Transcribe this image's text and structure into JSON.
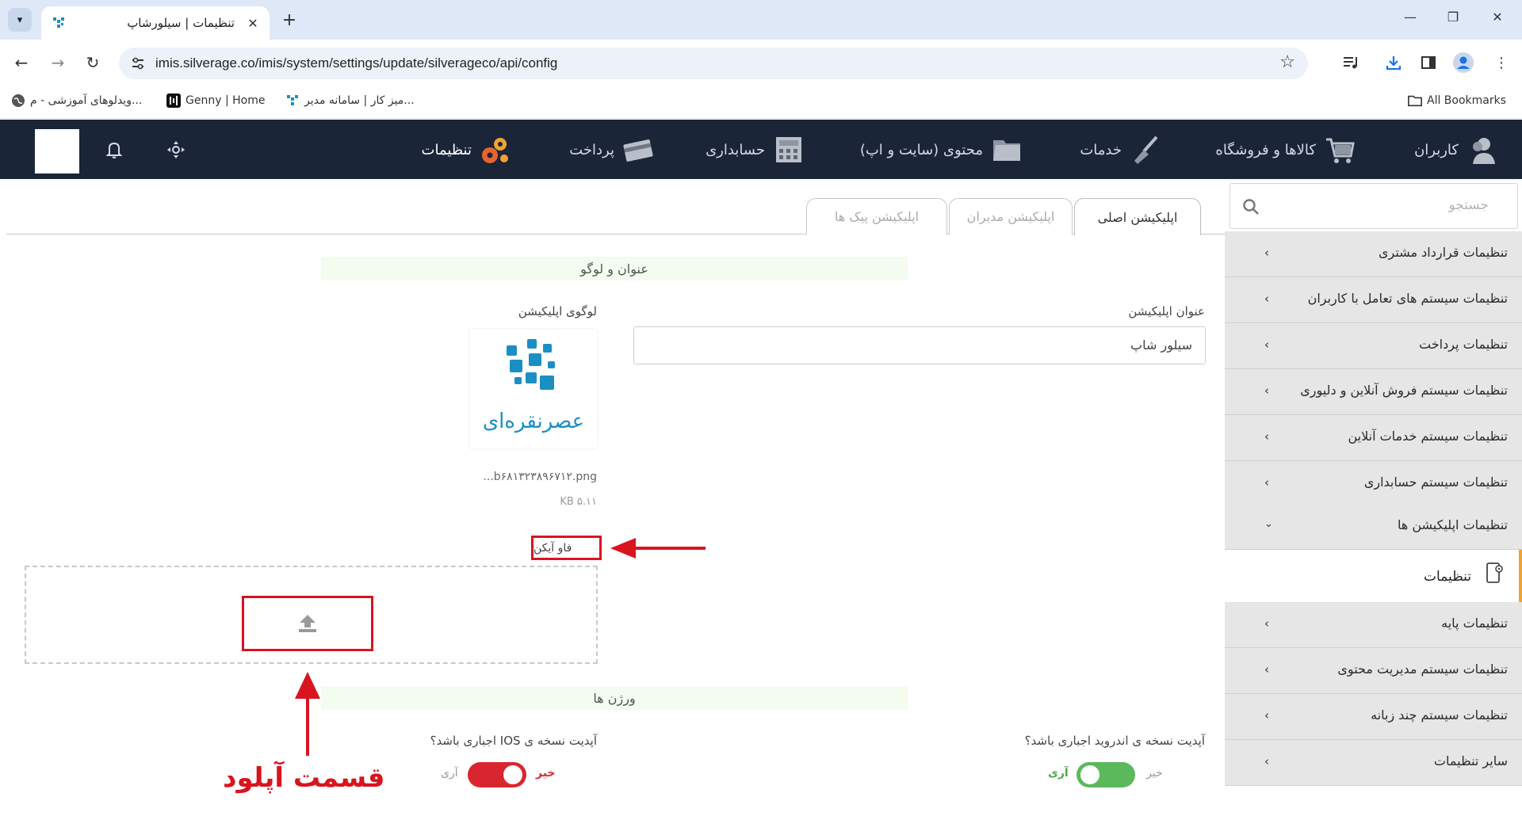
{
  "browser": {
    "tab_title": "تنظیمات | سیلورشاپ",
    "url": "imis.silverage.co/imis/system/settings/update/silverageco/api/config",
    "bookmarks": [
      {
        "label": "ویدلوهای آموزشی - م..."
      },
      {
        "label": "Genny | Home"
      },
      {
        "label": "میز کار | سامانه مدیر..."
      }
    ],
    "all_bookmarks": "All Bookmarks"
  },
  "app_nav": {
    "items": [
      {
        "label": "کاربران",
        "icon": "users-icon"
      },
      {
        "label": "کالاها و فروشگاه",
        "icon": "cart-icon"
      },
      {
        "label": "خدمات",
        "icon": "broom-icon"
      },
      {
        "label": "محتوی (سایت و اپ)",
        "icon": "folder-icon"
      },
      {
        "label": "حسابداری",
        "icon": "calculator-icon"
      },
      {
        "label": "پرداخت",
        "icon": "credit-card-icon"
      },
      {
        "label": "تنظیمات",
        "icon": "gears-icon"
      }
    ]
  },
  "sidebar": {
    "search_placeholder": "جستجو",
    "items": [
      {
        "label": "تنظیمات قرارداد مشتری"
      },
      {
        "label": "تنظیمات سیستم های تعامل با کاربران"
      },
      {
        "label": "تنظیمات پرداخت"
      },
      {
        "label": "تنظیمات سیستم فروش آنلاین و دلیوری"
      },
      {
        "label": "تنظیمات سیستم خدمات آنلاین"
      },
      {
        "label": "تنظیمات سیستم حسابداری"
      },
      {
        "label": "تنظیمات اپلیکیشن ها"
      }
    ],
    "active_sub": "تنظیمات",
    "items_after": [
      {
        "label": "تنظیمات پایه"
      },
      {
        "label": "تنظیمات سیستم مدیریت محتوی"
      },
      {
        "label": "تنظیمات سیستم چند زبانه"
      },
      {
        "label": "سایر تنظیمات"
      }
    ]
  },
  "content_tabs": [
    {
      "label": "اپلیکیشن اصلی",
      "active": true
    },
    {
      "label": "اپلیکیشن مدیران",
      "active": false
    },
    {
      "label": "اپلیکیشن پیک ها",
      "active": false
    }
  ],
  "section_title_logo": "عنوان و لوگو",
  "app_title_label": "عنوان اپلیکیشن",
  "app_title_value": "سیلور شاپ",
  "app_logo_label": "لوگوی اپلیکیشن",
  "logo_text": "عصرنقره‌ای",
  "logo_file_name": "...b۶۸۱۳۲۳۸۹۶۷۱۲.png",
  "logo_file_size": "KB ۵.۱۱",
  "favicon_label": "فاو آیکن",
  "annotation_text": "قسمت آپلود",
  "section_title_versions": "ورژن ها",
  "android_question": "آپدیت نسخه ی اندروید اجباری باشد؟",
  "ios_question": "آپدیت نسخه ی IOS اجباری باشد؟",
  "android_toggle": {
    "yes": "آری",
    "no": "خیر",
    "value": "yes",
    "color": "#5cb85c"
  },
  "ios_toggle": {
    "yes": "آری",
    "no": "خیر",
    "value": "no",
    "color": "#d9262e"
  },
  "colors": {
    "nav_bg": "#1b2538",
    "accent": "#f0a330",
    "annotation": "#d8141f"
  }
}
